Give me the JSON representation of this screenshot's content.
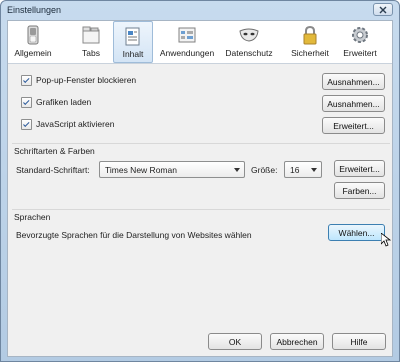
{
  "window": {
    "title": "Einstellungen"
  },
  "toolbar": {
    "items": [
      {
        "label": "Allgemein",
        "icon": "switch-icon"
      },
      {
        "label": "Tabs",
        "icon": "tabs-icon"
      },
      {
        "label": "Inhalt",
        "icon": "document-icon"
      },
      {
        "label": "Anwendungen",
        "icon": "applications-icon"
      },
      {
        "label": "Datenschutz",
        "icon": "mask-icon"
      },
      {
        "label": "Sicherheit",
        "icon": "lock-icon"
      },
      {
        "label": "Erweitert",
        "icon": "gear-icon"
      }
    ],
    "active_index": 2
  },
  "content": {
    "popups": {
      "label": "Pop-up-Fenster blockieren",
      "checked": true,
      "button": "Ausnahmen..."
    },
    "images": {
      "label": "Grafiken laden",
      "checked": true,
      "button": "Ausnahmen..."
    },
    "javascript": {
      "label": "JavaScript aktivieren",
      "checked": true,
      "button": "Erweitert..."
    }
  },
  "fonts": {
    "group_title": "Schriftarten & Farben",
    "default_font_label": "Standard-Schriftart:",
    "default_font_value": "Times New Roman",
    "size_label": "Größe:",
    "size_value": "16",
    "advanced_button": "Erweitert...",
    "colors_button": "Farben..."
  },
  "languages": {
    "group_title": "Sprachen",
    "description": "Bevorzugte Sprachen für die Darstellung von Websites wählen",
    "choose_button": "Wählen..."
  },
  "footer": {
    "ok": "OK",
    "cancel": "Abbrechen",
    "help": "Hilfe"
  },
  "colors": {
    "accent": "#3c7fb1",
    "check": "#2b5a9b"
  }
}
